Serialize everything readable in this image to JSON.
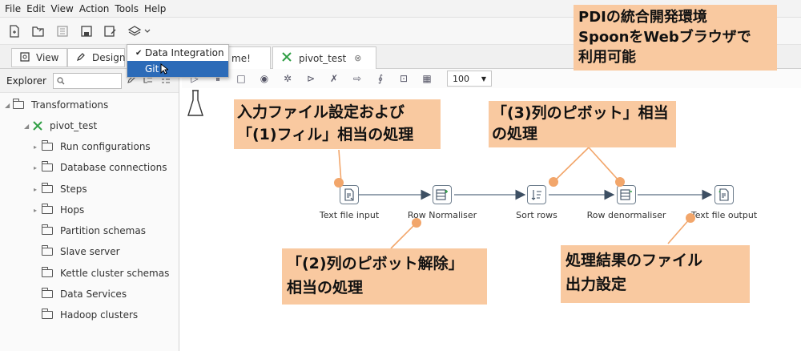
{
  "menu": [
    "File",
    "Edit",
    "View",
    "Action",
    "Tools",
    "Help"
  ],
  "perspective_tabs": {
    "view": "View",
    "design": "Design"
  },
  "dropdown": {
    "items": [
      "Data Integration",
      "Git"
    ]
  },
  "doc_tabs": {
    "welcome_fragment": "me!",
    "pivot": "pivot_test",
    "close_glyph": "⊗"
  },
  "explorer": {
    "title": "Explorer",
    "search_icon": "search-icon",
    "tree": [
      {
        "label": "Transformations"
      },
      {
        "label": "pivot_test"
      },
      {
        "label": "Run configurations"
      },
      {
        "label": "Database connections"
      },
      {
        "label": "Steps"
      },
      {
        "label": "Hops"
      },
      {
        "label": "Partition schemas"
      },
      {
        "label": "Slave server"
      },
      {
        "label": "Kettle cluster schemas"
      },
      {
        "label": "Data Services"
      },
      {
        "label": "Hadoop clusters"
      }
    ]
  },
  "canvas": {
    "zoom": "100"
  },
  "steps": [
    {
      "label": "Text file input",
      "icon": "file-input-icon"
    },
    {
      "label": "Row Normaliser",
      "icon": "normaliser-icon"
    },
    {
      "label": "Sort rows",
      "icon": "sort-icon"
    },
    {
      "label": "Row denormaliser",
      "icon": "denormaliser-icon"
    },
    {
      "label": "Text file output",
      "icon": "file-output-icon"
    }
  ],
  "callouts": {
    "pdi": [
      "PDIの統合開発環境",
      "SpoonをWebブラウザで",
      "利用可能"
    ],
    "input": [
      "入力ファイル設定および",
      "「(1)フィル」相当の処理"
    ],
    "pivot": [
      "「(3)列のピボット」相当",
      "の処理"
    ],
    "unpivot": [
      "「(2)列のピボット解除」",
      "相当の処理"
    ],
    "output": [
      "処理結果のファイル",
      "出力設定"
    ]
  },
  "colors": {
    "callout_bg": "#f9c9a0",
    "callout_dot": "#f2a66b",
    "selection": "#2c6bb8"
  }
}
